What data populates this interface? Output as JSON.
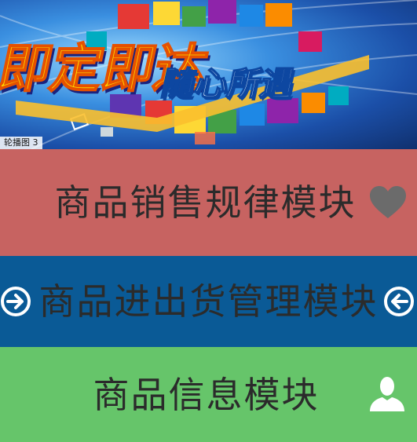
{
  "banner": {
    "caption": "轮播图 3",
    "headline_top": "即定即达",
    "headline_bottom": "随心所遇"
  },
  "modules": {
    "sales": {
      "label": "商品销售规律模块",
      "icon": "heart-icon"
    },
    "stock": {
      "label": "商品进出货管理模块",
      "icons": [
        "arrow-right-circle-icon",
        "arrow-left-circle-icon"
      ]
    },
    "info": {
      "label": "商品信息模块",
      "icon": "user-icon"
    }
  },
  "colors": {
    "sales_bg": "#c76361",
    "stock_bg": "#0a5a96",
    "info_bg": "#66c56a",
    "title_text": "#2b2b2b",
    "icon_gray": "#6b6b6b",
    "icon_white": "#ffffff"
  }
}
